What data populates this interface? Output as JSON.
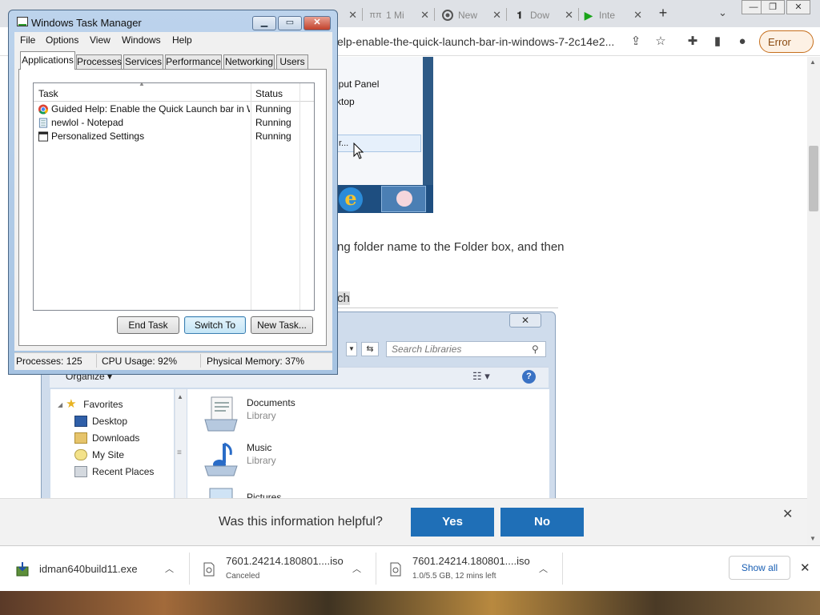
{
  "browser": {
    "tabs": [
      {
        "label": "1 Mi",
        "favicon": "pi"
      },
      {
        "label": "New",
        "favicon": "chrome-icon"
      },
      {
        "label": "Dow",
        "favicon": "dl-icon"
      },
      {
        "label": "Inte",
        "favicon": "play-icon"
      }
    ],
    "url_fragment": "elp-enable-the-quick-launch-bar-in-windows-7-2c14e2...",
    "error_label": "Error"
  },
  "page": {
    "shot_menu_items": [
      "iput Panel",
      "ktop"
    ],
    "shot_selected": "r...",
    "body_text": "ng folder name to the Folder box, and then",
    "body_text2": "ch",
    "explorer": {
      "close_glyph": "✕",
      "search_placeholder": "Search Libraries",
      "organize": "Organize ▾",
      "nav": [
        "Favorites",
        "Desktop",
        "Downloads",
        "My Site",
        "Recent Places"
      ],
      "libraries": [
        {
          "name": "Documents",
          "type": "Library"
        },
        {
          "name": "Music",
          "type": "Library"
        },
        {
          "name": "Pictures",
          "type": ""
        }
      ]
    }
  },
  "taskmanager": {
    "title": "Windows Task Manager",
    "menu": [
      "File",
      "Options",
      "View",
      "Windows",
      "Help"
    ],
    "tabs": [
      "Applications",
      "Processes",
      "Services",
      "Performance",
      "Networking",
      "Users"
    ],
    "columns": {
      "task": "Task",
      "status": "Status"
    },
    "rows": [
      {
        "task": "Guided Help: Enable the Quick Launch bar in Win...",
        "status": "Running"
      },
      {
        "task": "newlol - Notepad",
        "status": "Running"
      },
      {
        "task": "Personalized Settings",
        "status": "Running"
      }
    ],
    "buttons": {
      "end": "End Task",
      "switch": "Switch To",
      "new": "New Task..."
    },
    "status": {
      "processes": "Processes: 125",
      "cpu": "CPU Usage: 92%",
      "memory": "Physical Memory: 37%"
    }
  },
  "helpful": {
    "question": "Was this information helpful?",
    "yes": "Yes",
    "no": "No"
  },
  "downloads": [
    {
      "name": "idman640build11.exe",
      "sub": ""
    },
    {
      "name": "7601.24214.180801....iso",
      "sub": "Canceled"
    },
    {
      "name": "7601.24214.180801....iso",
      "sub": "1.0/5.5 GB, 12 mins left"
    }
  ],
  "shelf": {
    "show_all": "Show all"
  }
}
